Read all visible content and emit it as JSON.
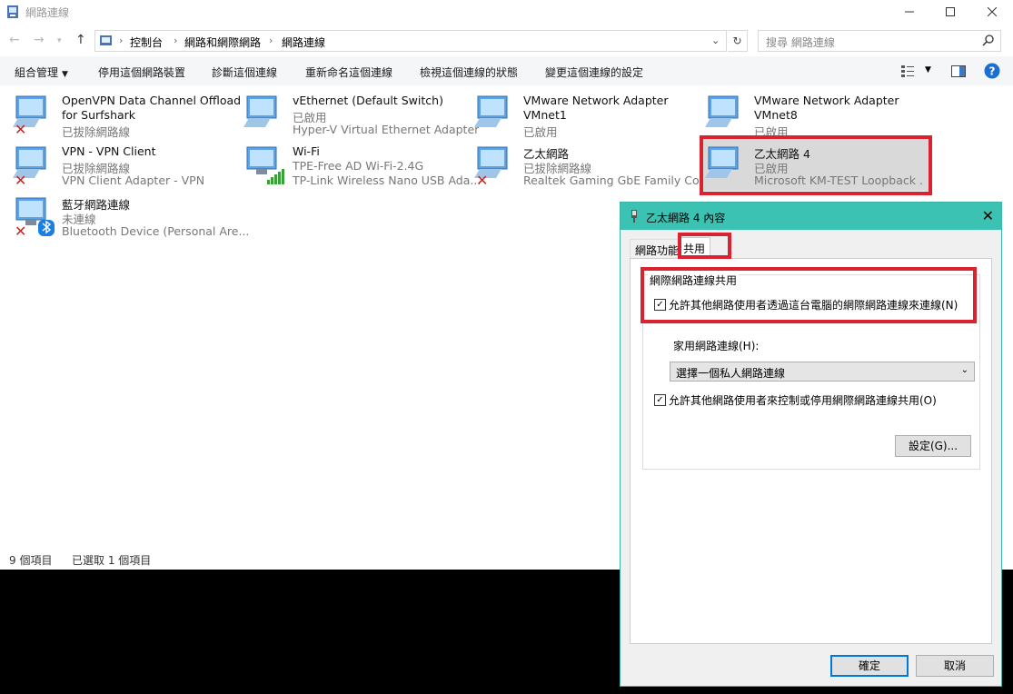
{
  "window": {
    "title": "網路連線",
    "minimize_icon": "minimize-icon",
    "maximize_icon": "maximize-icon",
    "close_icon": "close-icon"
  },
  "address": {
    "crumbs": [
      "控制台",
      "網路和網際網路",
      "網路連線"
    ],
    "search_placeholder": "搜尋 網路連線"
  },
  "toolbar": {
    "organize": "組合管理",
    "disable": "停用這個網路裝置",
    "diagnose": "診斷這個連線",
    "rename": "重新命名這個連線",
    "view_status": "檢視這個連線的狀態",
    "change_settings": "變更這個連線的設定"
  },
  "connections": [
    {
      "name": "OpenVPN Data Channel Offload",
      "name2": "for Surfshark",
      "status": "已拔除網路線",
      "device": "",
      "state": "disconnected"
    },
    {
      "name": "vEthernet (Default Switch)",
      "status": "已啟用",
      "device": "Hyper-V Virtual Ethernet Adapter",
      "state": "enabled"
    },
    {
      "name": "VMware Network Adapter",
      "name2": "VMnet1",
      "status": "已啟用",
      "device": "",
      "state": "enabled"
    },
    {
      "name": "VMware Network Adapter",
      "name2": "VMnet8",
      "status": "已啟用",
      "device": "",
      "state": "enabled"
    },
    {
      "name": "VPN - VPN Client",
      "status": "已拔除網路線",
      "device": "VPN Client Adapter - VPN",
      "state": "disconnected"
    },
    {
      "name": "Wi-Fi",
      "status": "TPE-Free AD Wi-Fi-2.4G",
      "device": "TP-Link Wireless Nano USB Ada...",
      "state": "wifi"
    },
    {
      "name": "乙太網路",
      "status": "已拔除網路線",
      "device": "Realtek Gaming GbE Family Co...",
      "state": "disconnected"
    },
    {
      "name": "乙太網路 4",
      "status": "已啟用",
      "device": "Microsoft KM-TEST Loopback ...",
      "state": "selected"
    },
    {
      "name": "藍牙網路連線",
      "status": "未連線",
      "device": "Bluetooth Device (Personal Are...",
      "state": "bluetooth"
    }
  ],
  "statusbar": {
    "count": "9 個項目",
    "selected": "已選取 1 個項目"
  },
  "dialog": {
    "title": "乙太網路 4 內容",
    "tab_network": "網路功能",
    "tab_sharing": "共用",
    "group_label": "網際網路連線共用",
    "allow_share": "允許其他網路使用者透過這台電腦的網際網路連線來連線(N)",
    "allow_share_checked": true,
    "home_label": "家用網路連線(H):",
    "home_select": "選擇一個私人網路連線",
    "allow_control": "允許其他網路使用者來控制或停用網際網路連線共用(O)",
    "allow_control_checked": true,
    "settings_button": "設定(G)...",
    "ok_button": "確定",
    "cancel_button": "取消"
  },
  "colors": {
    "highlight_red": "#d9232e",
    "dialog_title": "#3bc2b3",
    "selection": "#d9d9d9"
  }
}
